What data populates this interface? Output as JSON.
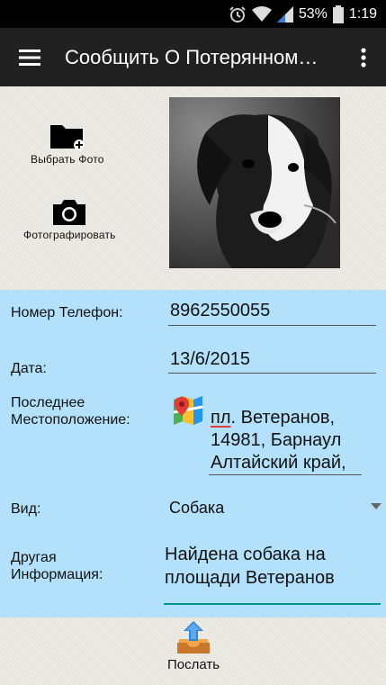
{
  "status_bar": {
    "battery": "53%",
    "time": "1:19"
  },
  "app_bar": {
    "title": "Сообщить О Потерянном…"
  },
  "photo_actions": {
    "choose_photo": "Выбрать Фото",
    "take_photo": "Фотографировать"
  },
  "form": {
    "phone": {
      "label": "Номер Телефон:",
      "value": "8962550055"
    },
    "date": {
      "label": "Дата:",
      "value": "13/6/2015"
    },
    "location": {
      "label_line1": "Последнее",
      "label_line2": "Местоположение:",
      "line1_prefix": "пл",
      "line1_rest": ". Ветеранов,",
      "line2": "14981, Барнаул",
      "line3": "Алтайский край,"
    },
    "type": {
      "label": "Вид:",
      "value": "Собака"
    },
    "info": {
      "label_line1": "Другая",
      "label_line2": "Информация:",
      "line1": "Найдена собака на",
      "line2": "площади Ветеранов"
    }
  },
  "send": {
    "label": "Послать"
  },
  "colors": {
    "form_bg": "#b3e1fb",
    "app_bar_bg": "#212121",
    "accent": "#009688"
  }
}
